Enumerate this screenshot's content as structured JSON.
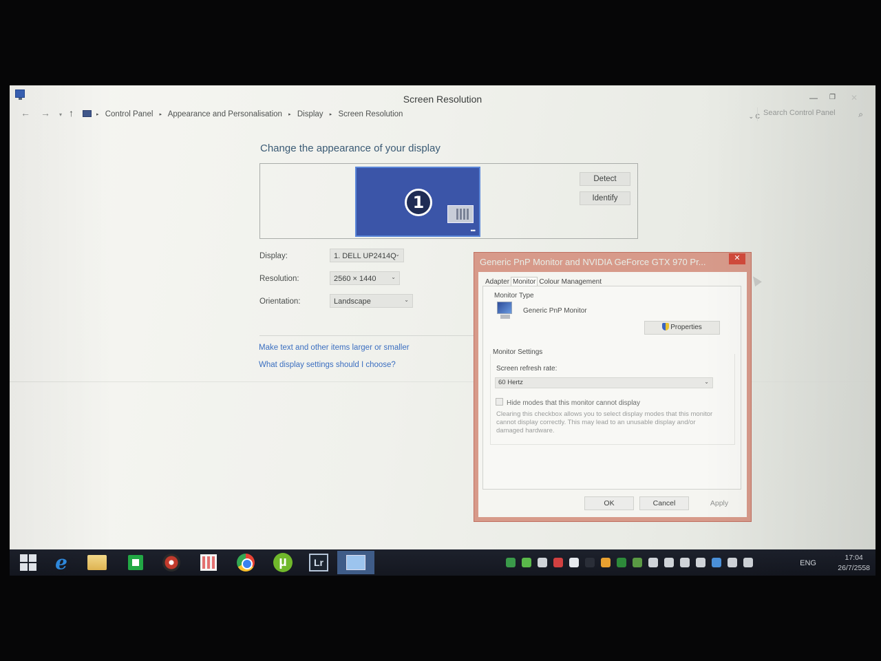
{
  "window": {
    "title": "Screen Resolution"
  },
  "navbar": {
    "back": "←",
    "forward": "→",
    "dropdown": "▾",
    "up": "↑",
    "breadcrumbs": [
      "Control Panel",
      "Appearance and Personalisation",
      "Display",
      "Screen Resolution"
    ],
    "separator": "▸",
    "address_controls": "⌄  C",
    "search_placeholder": "Search Control Panel",
    "search_icon": "⌕"
  },
  "main": {
    "heading": "Change the appearance of your display",
    "monitor_number": "1",
    "monitor_dots": "•••",
    "detect_label": "Detect",
    "identify_label": "Identify",
    "display_label": "Display:",
    "display_value": "1. DELL UP2414Q",
    "resolution_label": "Resolution:",
    "resolution_value": "2560 × 1440",
    "orientation_label": "Orientation:",
    "orientation_value": "Landscape",
    "chevron": "⌄",
    "link_text_size": "Make text and other items larger or smaller",
    "link_settings": "What display settings should I choose?"
  },
  "dialog": {
    "title": "Generic PnP Monitor and NVIDIA GeForce GTX 970 Pr...",
    "close": "✕",
    "tabs": [
      "Adapter",
      "Monitor",
      "Colour Management"
    ],
    "active_tab": "Monitor",
    "monitor_type_label": "Monitor Type",
    "monitor_name": "Generic PnP Monitor",
    "properties_label": "Properties",
    "monitor_settings_label": "Monitor Settings",
    "refresh_label": "Screen refresh rate:",
    "refresh_value": "60 Hertz",
    "hide_modes_label": "Hide modes that this monitor cannot display",
    "hide_modes_checked": false,
    "help_text": "Clearing this checkbox allows you to select display modes that this monitor cannot display correctly. This may lead to an unusable display and/or damaged hardware.",
    "ok_label": "OK",
    "cancel_label": "Cancel",
    "apply_label": "Apply"
  },
  "taskbar": {
    "ie_glyph": "e",
    "utorrent_glyph": "µ",
    "lightroom_glyph": "Lr",
    "language": "ENG",
    "time": "17:04",
    "date": "26/7/2558",
    "tray_colors": [
      "#3a9a4a",
      "#5ab84a",
      "#cfd3d8",
      "#d14040",
      "#e6e9ee",
      "#2a2e38",
      "#e8a030",
      "#2d8a3a",
      "#5a9a44",
      "#cfd3d8",
      "#cfd3d8",
      "#cfd3d8",
      "#cfd3d8",
      "#4a90d8",
      "#cfd3d8",
      "#cfd3d8"
    ]
  }
}
